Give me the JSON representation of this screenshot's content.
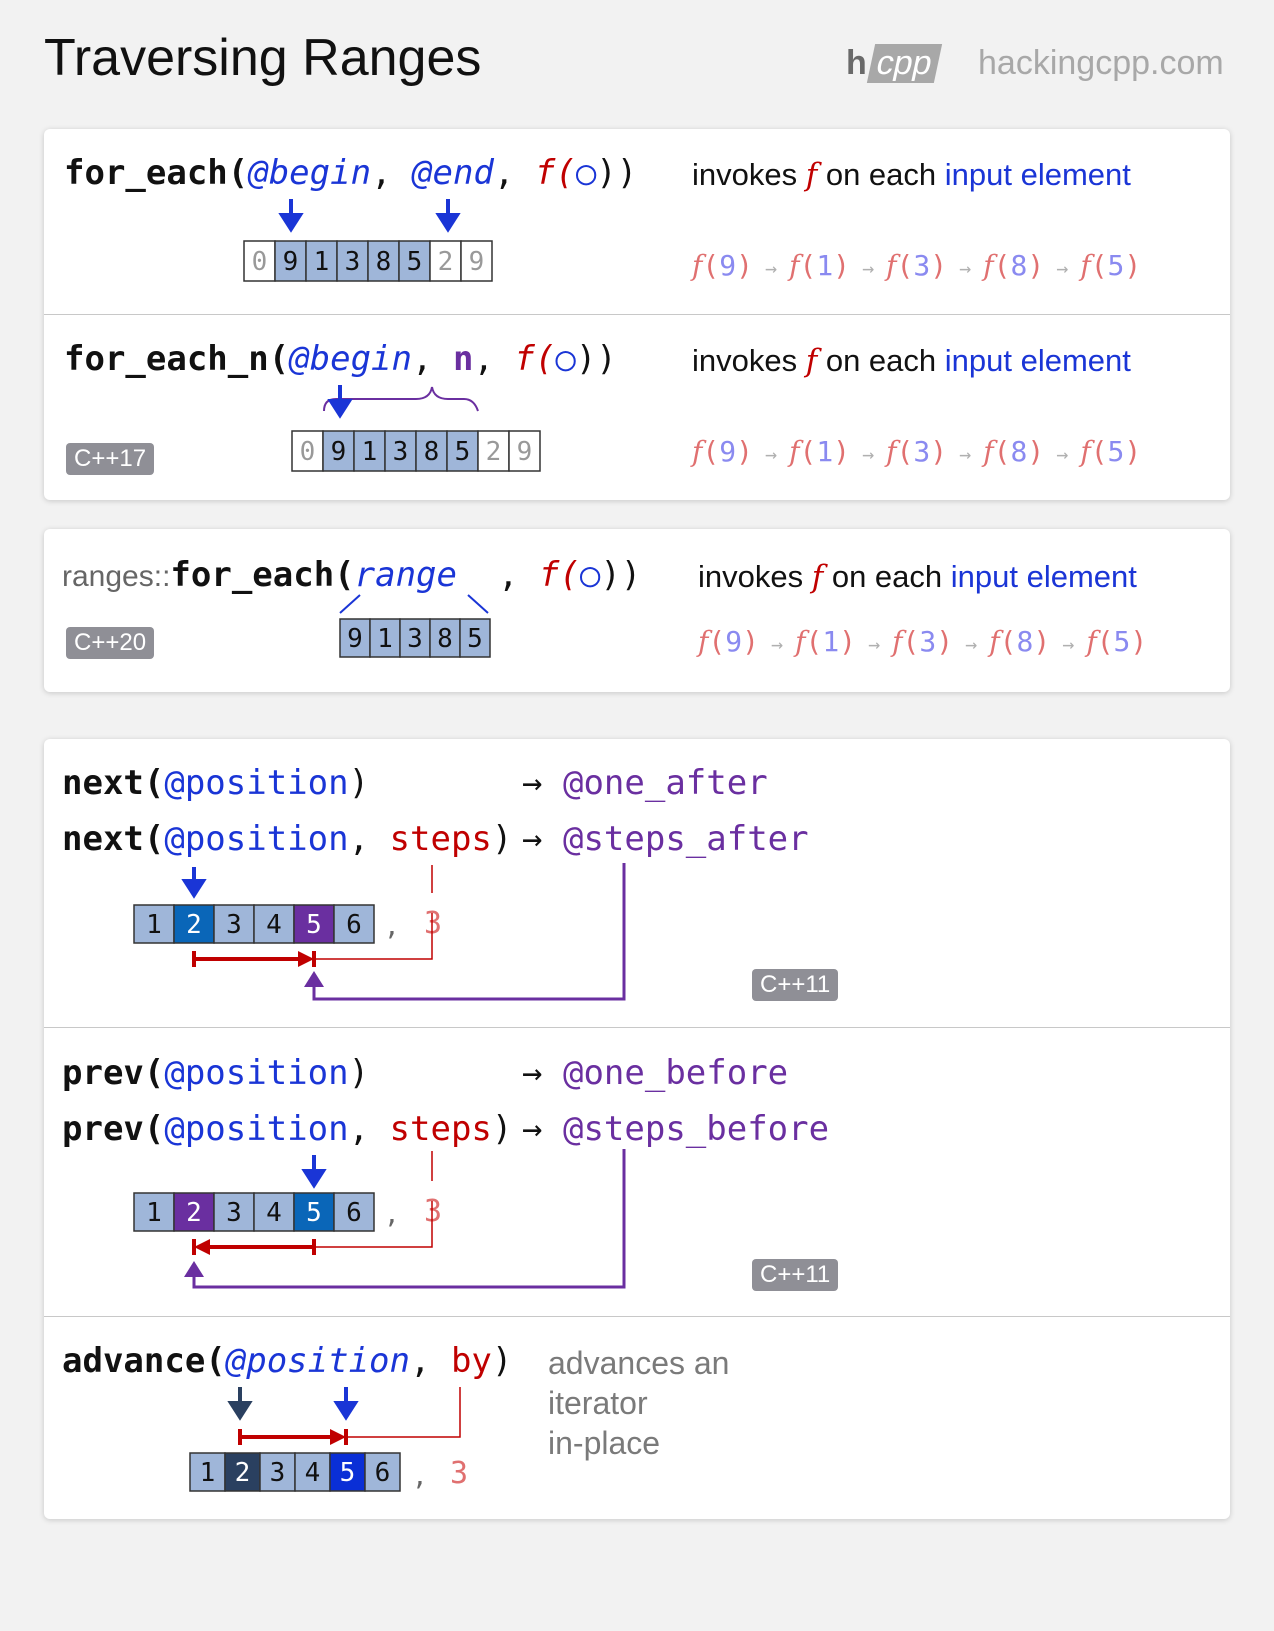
{
  "page": {
    "title": "Traversing Ranges",
    "logo_h": "h",
    "logo_cpp": "cpp",
    "site": "hackingcpp.com"
  },
  "for_each": {
    "fn": "for_each(",
    "begin": "@begin",
    "sep1": ", ",
    "end": "@end",
    "sep2": ", ",
    "f": "f(",
    "circ": "○",
    "close": "))",
    "desc_pre": "invokes ",
    "desc_f": "f",
    "desc_mid": " on each ",
    "desc_hl": "input element",
    "cells": [
      "0",
      "9",
      "1",
      "3",
      "8",
      "5",
      "2",
      "9"
    ]
  },
  "for_each_n": {
    "fn": "for_each_n(",
    "begin": "@begin",
    "sep1": ", ",
    "n": "n",
    "sep2": ", ",
    "f": "f(",
    "circ": "○",
    "close": "))",
    "badge": "C++17",
    "desc_pre": "invokes ",
    "desc_f": "f",
    "desc_mid": " on each ",
    "desc_hl": "input element",
    "cells": [
      "0",
      "9",
      "1",
      "3",
      "8",
      "5",
      "2",
      "9"
    ]
  },
  "ranges_for_each": {
    "ns": "ranges::",
    "fn": "for_each(",
    "range": "range",
    "sep": "  , ",
    "f": "f(",
    "circ": "○",
    "close": "))",
    "badge": "C++20",
    "desc_pre": "invokes ",
    "desc_f": "f",
    "desc_mid": " on each ",
    "desc_hl": "input element",
    "cells": [
      "9",
      "1",
      "3",
      "8",
      "5"
    ]
  },
  "call_chain": [
    "f(9)",
    "f(1)",
    "f(3)",
    "f(8)",
    "f(5)"
  ],
  "next": {
    "line1_fn": "next(",
    "line1_arg": "@position",
    "line1_close": ")",
    "line1_result": "@one_after",
    "line2_fn": "next(",
    "line2_arg": "@position",
    "line2_sep": ", ",
    "line2_steps": "steps",
    "line2_close": ")",
    "line2_result": "@steps_after",
    "arrow": "→",
    "cells": [
      "1",
      "2",
      "3",
      "4",
      "5",
      "6"
    ],
    "steps_value": "3",
    "comma": ",",
    "badge": "C++11"
  },
  "prev": {
    "line1_fn": "prev(",
    "line1_arg": "@position",
    "line1_close": ")",
    "line1_result": "@one_before",
    "line2_fn": "prev(",
    "line2_arg": "@position",
    "line2_sep": ", ",
    "line2_steps": "steps",
    "line2_close": ")",
    "line2_result": "@steps_before",
    "arrow": "→",
    "cells": [
      "1",
      "2",
      "3",
      "4",
      "5",
      "6"
    ],
    "steps_value": "3",
    "comma": ",",
    "badge": "C++11"
  },
  "advance": {
    "fn": "advance(",
    "arg": "@position",
    "sep": ", ",
    "by": "by",
    "close": ")",
    "desc_line1": "advances an",
    "desc_line2": "iterator",
    "desc_line3": "in-place",
    "cells": [
      "1",
      "2",
      "3",
      "4",
      "5",
      "6"
    ],
    "by_value": "3",
    "comma": ","
  },
  "colors": {
    "cell_fill": "#9fb6d9",
    "cell_plain": "#ffffff",
    "purple": "#6a2fa0",
    "blue": "#1a35d6",
    "dark_blue": "#0a66b8",
    "navy": "#2a4060",
    "red": "#c00000",
    "badge": "#8f8f96"
  }
}
